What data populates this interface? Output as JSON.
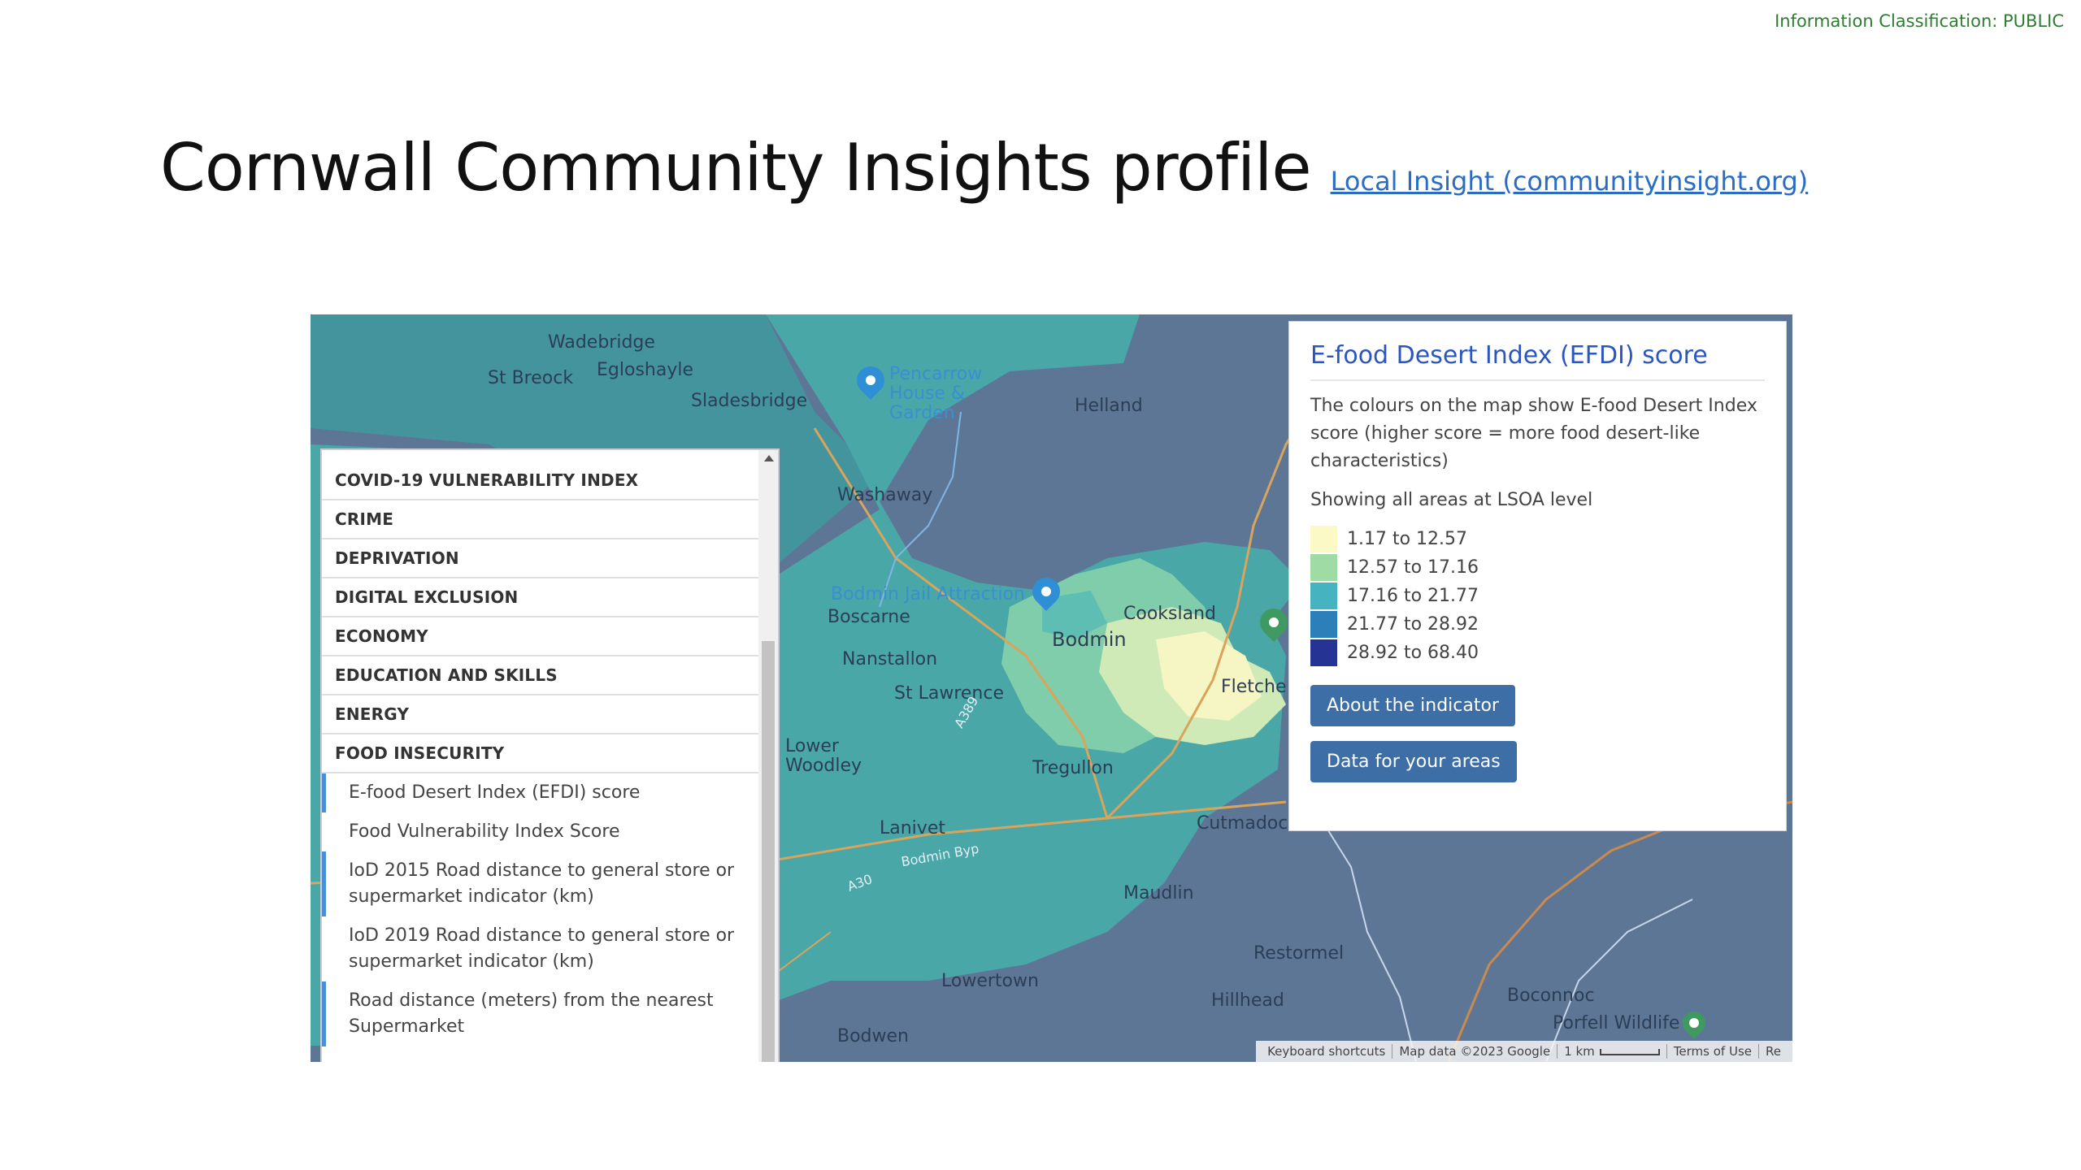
{
  "classification": "Information Classification: PUBLIC",
  "title": "Cornwall Community Insights profile",
  "title_link": "Local Insight (communityinsight.org)",
  "categories": [
    "COVID-19 VULNERABILITY INDEX",
    "CRIME",
    "DEPRIVATION",
    "DIGITAL EXCLUSION",
    "ECONOMY",
    "EDUCATION AND SKILLS",
    "ENERGY",
    "FOOD INSECURITY"
  ],
  "food_items": [
    "E-food Desert Index (EFDI) score",
    "Food Vulnerability Index Score",
    "IoD 2015 Road distance to general store or supermarket indicator (km)",
    "IoD 2019 Road distance to general store or supermarket indicator (km)",
    "Road distance (meters) from the nearest Supermarket"
  ],
  "legend": {
    "title": "E-food Desert Index (EFDI) score",
    "description": "The colours on the map show E-food Desert Index score (higher score = more food desert-like characteristics)",
    "level": "Showing all areas at LSOA level",
    "ranges": [
      {
        "label": "1.17 to 12.57",
        "color": "#fbf9c5"
      },
      {
        "label": "12.57 to 17.16",
        "color": "#9fdba5"
      },
      {
        "label": "17.16 to 21.77",
        "color": "#45b3c0"
      },
      {
        "label": "21.77 to 28.92",
        "color": "#2c7fb8"
      },
      {
        "label": "28.92 to 68.40",
        "color": "#253494"
      }
    ],
    "about_button": "About the indicator",
    "data_button": "Data for your areas"
  },
  "map_labels": {
    "wadebridge": "Wadebridge",
    "egloshayle": "Egloshayle",
    "st_breock": "St Breock",
    "sladesbridge": "Sladesbridge",
    "pencarrow": "Pencarrow House & Garden",
    "helland": "Helland",
    "washaway": "Washaway",
    "bodmin_jail": "Bodmin Jail Attraction",
    "boscarne": "Boscarne",
    "bodmin": "Bodmin",
    "cooksland": "Cooksland",
    "nanstallon": "Nanstallon",
    "st_lawrence": "St Lawrence",
    "fletchers": "Fletche",
    "lower_woodley": "Lower Woodley",
    "tregullon": "Tregullon",
    "lanivet": "Lanivet",
    "cutmadoc": "Cutmadoc",
    "maudlin": "Maudlin",
    "restormel": "Restormel",
    "lowertown": "Lowertown",
    "hillhead": "Hillhead",
    "boconnoc": "Boconnoc",
    "porfell": "Porfell Wildlife",
    "bodwen": "Bodwen",
    "a389": "A389",
    "a30": "A30",
    "bodmin_byp": "Bodmin Byp"
  },
  "attribution": {
    "shortcuts": "Keyboard shortcuts",
    "map_data": "Map data ©2023 Google",
    "scale": "1 km",
    "terms": "Terms of Use",
    "report": "Re"
  }
}
